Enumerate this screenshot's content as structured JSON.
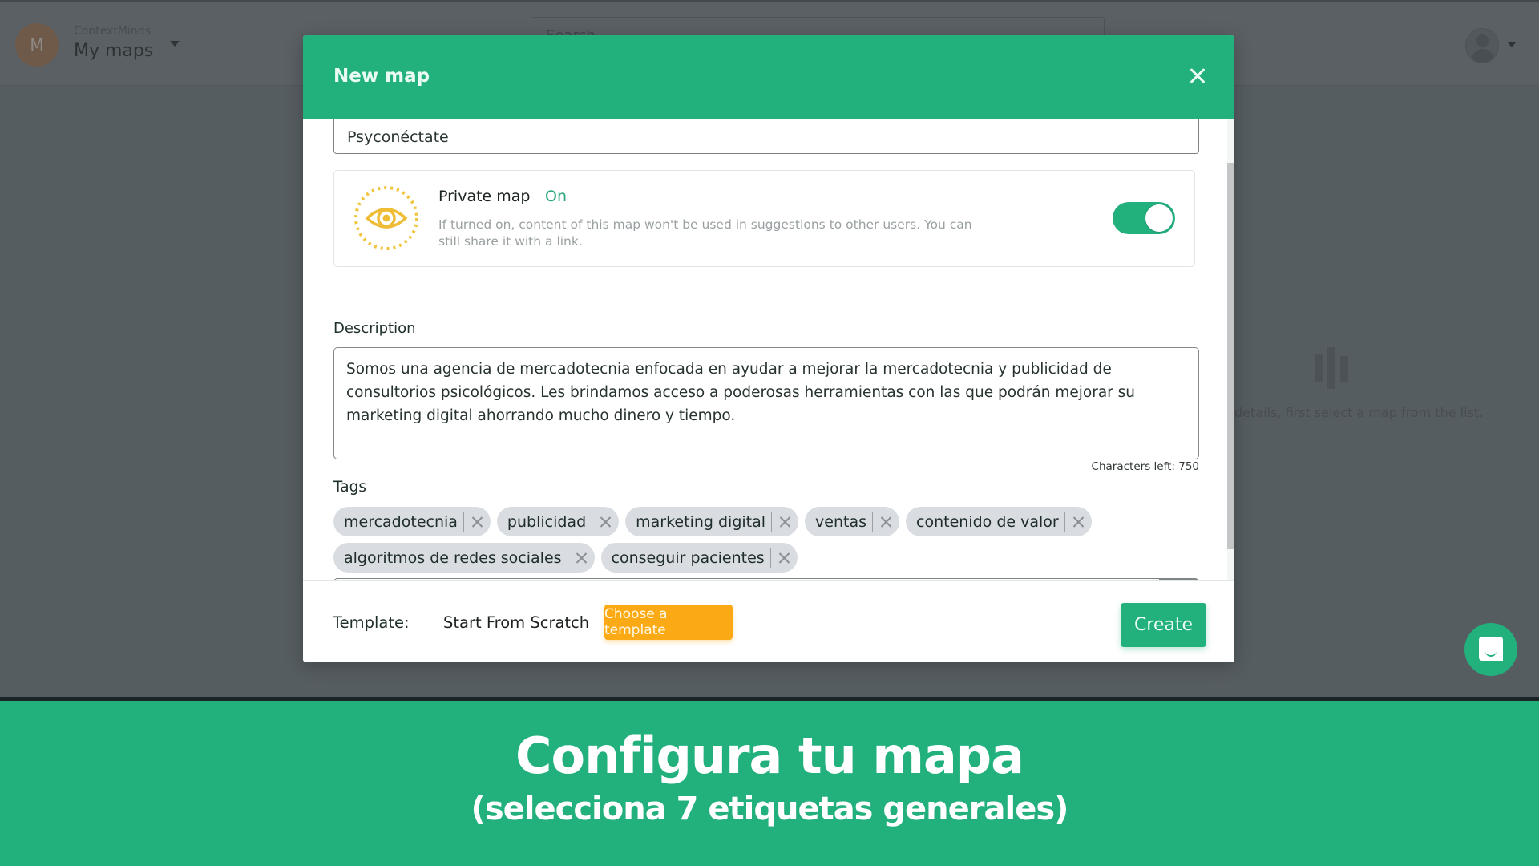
{
  "app": {
    "brand": "ContextMinds",
    "section_title": "My maps",
    "user_initial": "M",
    "search_placeholder": "Search",
    "details_hint": "details, first select a map from the list."
  },
  "modal": {
    "title": "New map",
    "map_name": "Psyconéctate",
    "private": {
      "label": "Private map",
      "state": "On",
      "enabled": true,
      "hint": "If turned on, content of this map won't be used in suggestions to other users. You can still share it with a link."
    },
    "description": {
      "label": "Description",
      "value": "Somos una agencia de mercadotecnia enfocada en ayudar a mejorar la mercadotecnia y publicidad de consultorios psicológicos. Les brindamos acceso a poderosas herramientas con las que podrán mejorar su marketing digital ahorrando mucho dinero y tiempo.",
      "chars_left": "Characters left: 750"
    },
    "tags": {
      "label": "Tags",
      "items": [
        "mercadotecnia",
        "publicidad",
        "marketing digital",
        "ventas",
        "contenido de valor",
        "algoritmos de redes sociales",
        "conseguir pacientes"
      ],
      "input_value": ""
    },
    "footer": {
      "template_label": "Template:",
      "template_value": "Start From Scratch",
      "choose_template_label": "Choose a template",
      "create_label": "Create"
    }
  },
  "banner": {
    "title": "Configura tu mapa",
    "subtitle": "(selecciona 7 etiquetas generales)"
  },
  "colors": {
    "accent": "#22b07d",
    "template_button": "#fbaa15",
    "overlay": "#565d61"
  }
}
